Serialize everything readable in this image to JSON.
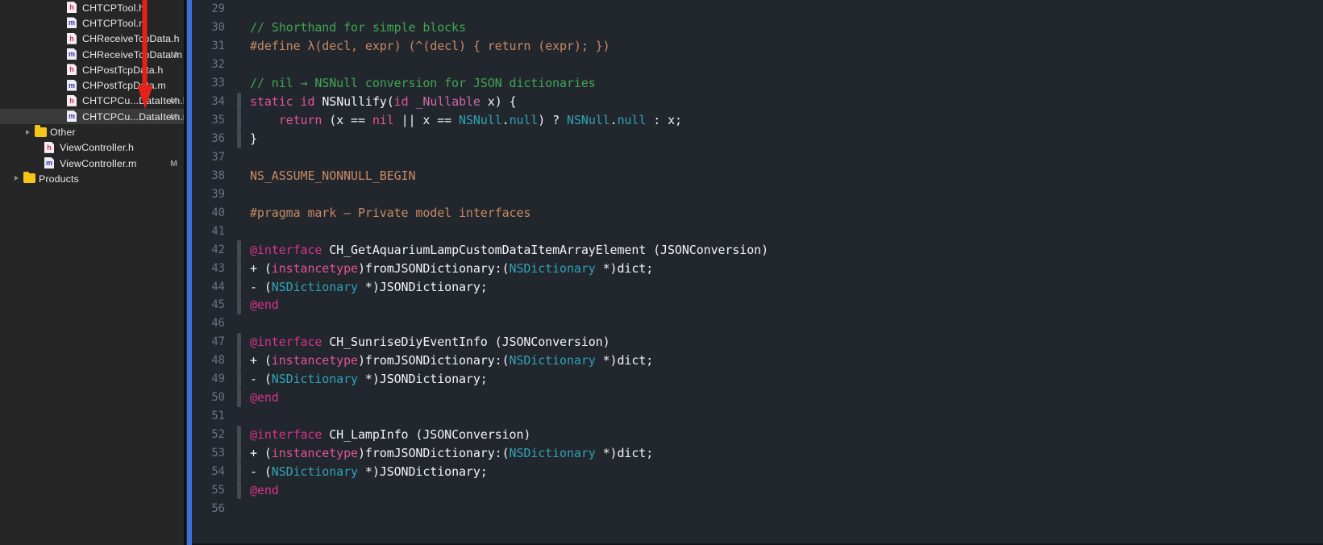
{
  "sidebar": {
    "rows": [
      {
        "icon": "file-h-icon",
        "type": "h",
        "indent": 70,
        "label": "CHTCPTool.h",
        "status": "",
        "selected": false,
        "twisty": false
      },
      {
        "icon": "file-m-icon",
        "type": "m",
        "indent": 70,
        "label": "CHTCPTool.m",
        "status": "",
        "selected": false,
        "twisty": false
      },
      {
        "icon": "file-h-icon",
        "type": "h",
        "indent": 70,
        "label": "CHReceiveTcpData.h",
        "status": "",
        "selected": false,
        "twisty": false
      },
      {
        "icon": "file-m-icon",
        "type": "m",
        "indent": 70,
        "label": "CHReceiveTcpData.m",
        "status": "M",
        "selected": false,
        "twisty": false
      },
      {
        "icon": "file-h-icon",
        "type": "h",
        "indent": 70,
        "label": "CHPostTcpData.h",
        "status": "",
        "selected": false,
        "twisty": false
      },
      {
        "icon": "file-m-icon",
        "type": "m",
        "indent": 70,
        "label": "CHPostTcpData.m",
        "status": "",
        "selected": false,
        "twisty": false
      },
      {
        "icon": "file-h-icon",
        "type": "h",
        "indent": 70,
        "label": "CHTCPCu...DataItem.h",
        "status": "M",
        "selected": false,
        "twisty": false
      },
      {
        "icon": "file-m-icon",
        "type": "m",
        "indent": 70,
        "label": "CHTCPCu...DataItem.m",
        "status": "M",
        "selected": true,
        "twisty": false
      },
      {
        "icon": "folder-icon",
        "type": "folder",
        "indent": 30,
        "label": "Other",
        "status": "",
        "selected": false,
        "twisty": true
      },
      {
        "icon": "file-h-icon",
        "type": "h",
        "indent": 42,
        "label": "ViewController.h",
        "status": "",
        "selected": false,
        "twisty": false
      },
      {
        "icon": "file-m-icon",
        "type": "m",
        "indent": 42,
        "label": "ViewController.m",
        "status": "M",
        "selected": false,
        "twisty": false
      },
      {
        "icon": "folder-icon",
        "type": "folder",
        "indent": 16,
        "label": "Products",
        "status": "",
        "selected": false,
        "twisty": true
      }
    ],
    "annotation": {
      "name": "red-down-arrow",
      "color": "#e8201a"
    }
  },
  "editor": {
    "accent_color": "#3b6fd4",
    "background": "#22262d",
    "lines": [
      {
        "n": "29",
        "fold": false,
        "tokens": []
      },
      {
        "n": "30",
        "fold": false,
        "tokens": [
          {
            "t": "// Shorthand for simple blocks",
            "c": "cm"
          }
        ]
      },
      {
        "n": "31",
        "fold": false,
        "tokens": [
          {
            "t": "#define λ(decl, expr) (^(decl) { return (expr); })",
            "c": "pp"
          }
        ]
      },
      {
        "n": "32",
        "fold": false,
        "tokens": []
      },
      {
        "n": "33",
        "fold": false,
        "tokens": [
          {
            "t": "// nil → NSNull conversion for JSON dictionaries",
            "c": "cm"
          }
        ]
      },
      {
        "n": "34",
        "fold": true,
        "tokens": [
          {
            "t": "static",
            "c": "kw"
          },
          {
            "t": " ",
            "c": "pl"
          },
          {
            "t": "id",
            "c": "kw"
          },
          {
            "t": " NSNullify(",
            "c": "pl"
          },
          {
            "t": "id",
            "c": "kw"
          },
          {
            "t": " ",
            "c": "pl"
          },
          {
            "t": "_Nullable",
            "c": "kw2"
          },
          {
            "t": " x) {",
            "c": "pl"
          }
        ]
      },
      {
        "n": "35",
        "fold": true,
        "tokens": [
          {
            "t": "    ",
            "c": "pl"
          },
          {
            "t": "return",
            "c": "kw"
          },
          {
            "t": " (x == ",
            "c": "pl"
          },
          {
            "t": "nil",
            "c": "kw"
          },
          {
            "t": " || x == ",
            "c": "pl"
          },
          {
            "t": "NSNull",
            "c": "ty"
          },
          {
            "t": ".",
            "c": "pl"
          },
          {
            "t": "null",
            "c": "ty"
          },
          {
            "t": ") ? ",
            "c": "pl"
          },
          {
            "t": "NSNull",
            "c": "ty"
          },
          {
            "t": ".",
            "c": "pl"
          },
          {
            "t": "null",
            "c": "ty"
          },
          {
            "t": " : x;",
            "c": "pl"
          }
        ]
      },
      {
        "n": "36",
        "fold": true,
        "tokens": [
          {
            "t": "}",
            "c": "pl"
          }
        ]
      },
      {
        "n": "37",
        "fold": false,
        "tokens": []
      },
      {
        "n": "38",
        "fold": false,
        "tokens": [
          {
            "t": "NS_ASSUME_NONNULL_BEGIN",
            "c": "pp"
          }
        ]
      },
      {
        "n": "39",
        "fold": false,
        "tokens": []
      },
      {
        "n": "40",
        "fold": false,
        "tokens": [
          {
            "t": "#pragma mark — Private model interfaces",
            "c": "pp"
          }
        ]
      },
      {
        "n": "41",
        "fold": false,
        "tokens": []
      },
      {
        "n": "42",
        "fold": true,
        "tokens": [
          {
            "t": "@interface",
            "c": "at"
          },
          {
            "t": " CH_GetAquariumLampCustomDataItemArrayElement (JSONConversion)",
            "c": "pl"
          }
        ]
      },
      {
        "n": "43",
        "fold": true,
        "tokens": [
          {
            "t": "+ (",
            "c": "pl"
          },
          {
            "t": "instancetype",
            "c": "kw"
          },
          {
            "t": ")fromJSONDictionary:(",
            "c": "pl"
          },
          {
            "t": "NSDictionary",
            "c": "ty"
          },
          {
            "t": " *)dict;",
            "c": "pl"
          }
        ]
      },
      {
        "n": "44",
        "fold": true,
        "tokens": [
          {
            "t": "- (",
            "c": "pl"
          },
          {
            "t": "NSDictionary",
            "c": "ty"
          },
          {
            "t": " *)JSONDictionary;",
            "c": "pl"
          }
        ]
      },
      {
        "n": "45",
        "fold": true,
        "tokens": [
          {
            "t": "@end",
            "c": "at"
          }
        ]
      },
      {
        "n": "46",
        "fold": false,
        "tokens": []
      },
      {
        "n": "47",
        "fold": true,
        "tokens": [
          {
            "t": "@interface",
            "c": "at"
          },
          {
            "t": " CH_SunriseDiyEventInfo (JSONConversion)",
            "c": "pl"
          }
        ]
      },
      {
        "n": "48",
        "fold": true,
        "tokens": [
          {
            "t": "+ (",
            "c": "pl"
          },
          {
            "t": "instancetype",
            "c": "kw"
          },
          {
            "t": ")fromJSONDictionary:(",
            "c": "pl"
          },
          {
            "t": "NSDictionary",
            "c": "ty"
          },
          {
            "t": " *)dict;",
            "c": "pl"
          }
        ]
      },
      {
        "n": "49",
        "fold": true,
        "tokens": [
          {
            "t": "- (",
            "c": "pl"
          },
          {
            "t": "NSDictionary",
            "c": "ty"
          },
          {
            "t": " *)JSONDictionary;",
            "c": "pl"
          }
        ]
      },
      {
        "n": "50",
        "fold": true,
        "tokens": [
          {
            "t": "@end",
            "c": "at"
          }
        ]
      },
      {
        "n": "51",
        "fold": false,
        "tokens": []
      },
      {
        "n": "52",
        "fold": true,
        "tokens": [
          {
            "t": "@interface",
            "c": "at"
          },
          {
            "t": " CH_LampInfo (JSONConversion)",
            "c": "pl"
          }
        ]
      },
      {
        "n": "53",
        "fold": true,
        "tokens": [
          {
            "t": "+ (",
            "c": "pl"
          },
          {
            "t": "instancetype",
            "c": "kw"
          },
          {
            "t": ")fromJSONDictionary:(",
            "c": "pl"
          },
          {
            "t": "NSDictionary",
            "c": "ty"
          },
          {
            "t": " *)dict;",
            "c": "pl"
          }
        ]
      },
      {
        "n": "54",
        "fold": true,
        "tokens": [
          {
            "t": "- (",
            "c": "pl"
          },
          {
            "t": "NSDictionary",
            "c": "ty"
          },
          {
            "t": " *)JSONDictionary;",
            "c": "pl"
          }
        ]
      },
      {
        "n": "55",
        "fold": true,
        "tokens": [
          {
            "t": "@end",
            "c": "at"
          }
        ]
      },
      {
        "n": "56",
        "fold": false,
        "tokens": []
      }
    ]
  }
}
